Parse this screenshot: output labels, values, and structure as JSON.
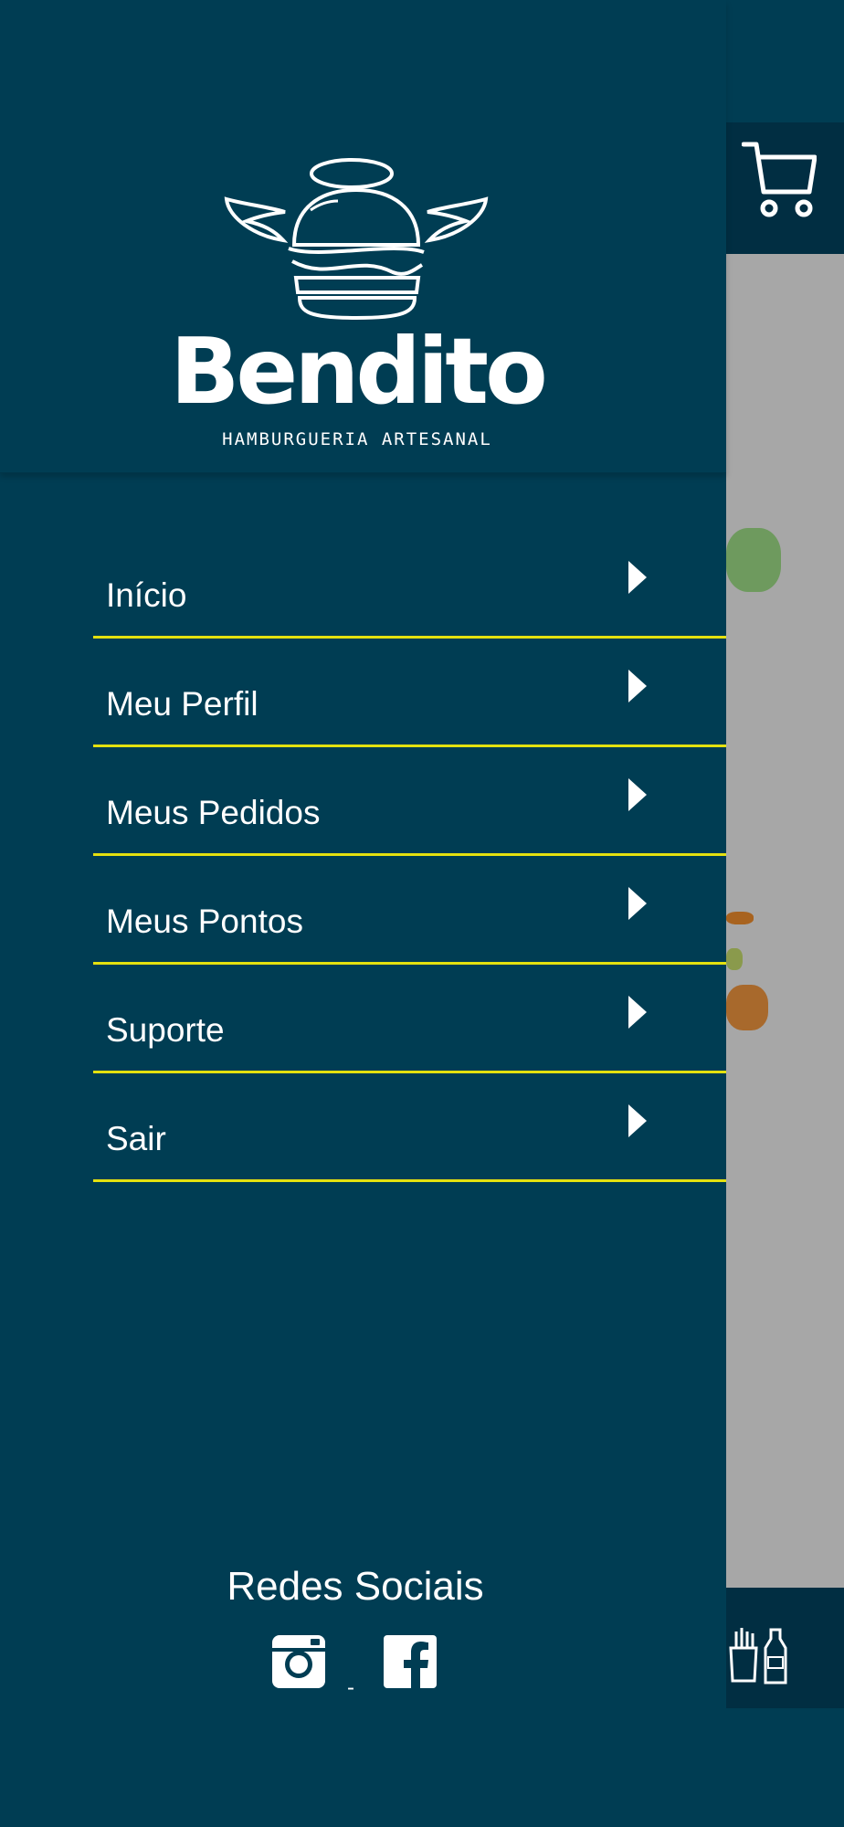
{
  "brand": {
    "name": "Bendito",
    "tagline": "HAMBURGUERIA ARTESANAL",
    "logo_icon": "winged-burger-halo-icon"
  },
  "menu": {
    "items": [
      {
        "label": "Início",
        "icon": "chevron-right-icon"
      },
      {
        "label": "Meu Perfil",
        "icon": "chevron-right-icon"
      },
      {
        "label": "Meus Pedidos",
        "icon": "chevron-right-icon"
      },
      {
        "label": "Meus Pontos",
        "icon": "chevron-right-icon"
      },
      {
        "label": "Suporte",
        "icon": "chevron-right-icon"
      },
      {
        "label": "Sair",
        "icon": "chevron-right-icon"
      }
    ]
  },
  "social": {
    "title": "Redes Sociais",
    "separator": "-",
    "icons": [
      "instagram-icon",
      "facebook-icon"
    ]
  },
  "background_app": {
    "icons": [
      "cart-icon",
      "fries-drink-icon"
    ]
  },
  "colors": {
    "drawer_bg": "#003d53",
    "bar_bg": "#012e42",
    "divider": "#e4e10f",
    "text": "#ffffff",
    "scrim_content": "#a7a7a7"
  }
}
